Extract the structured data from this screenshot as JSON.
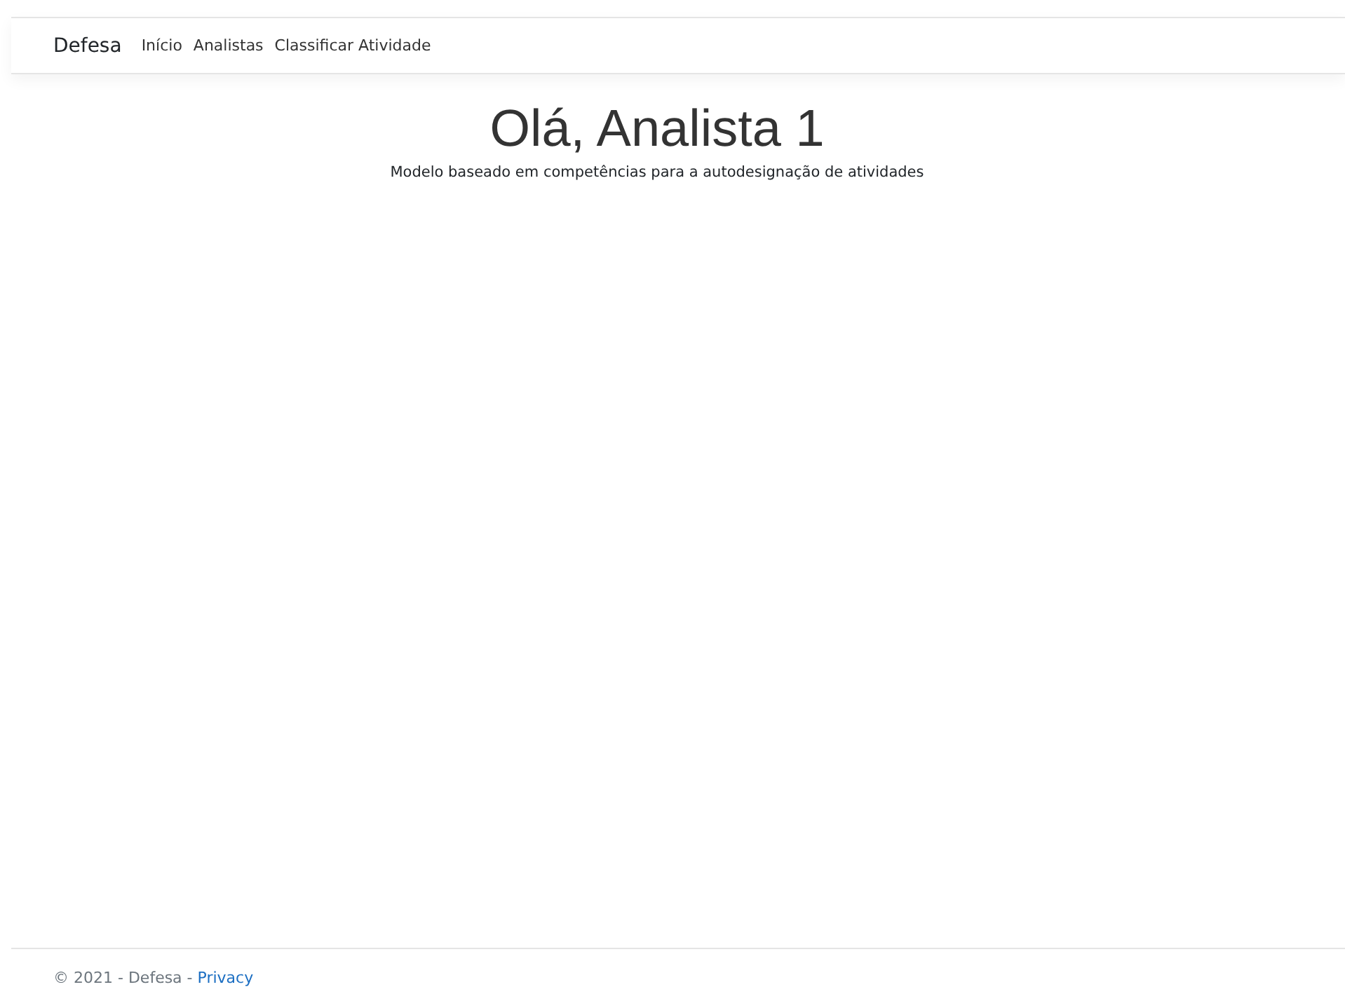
{
  "navbar": {
    "brand": "Defesa",
    "links": [
      "Início",
      "Analistas",
      "Classificar Atividade"
    ]
  },
  "main": {
    "heading": "Olá, Analista 1",
    "subtitle": "Modelo baseado em competências para a autodesignação de atividades"
  },
  "footer": {
    "text": "© 2021 - Defesa - ",
    "link": "Privacy"
  }
}
